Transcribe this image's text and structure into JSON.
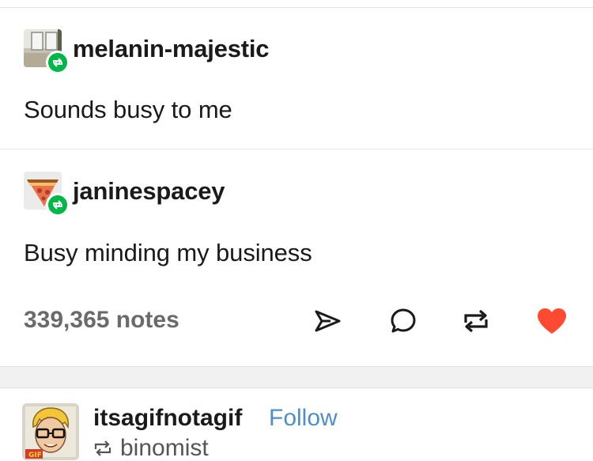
{
  "reblog_chain": [
    {
      "username": "melanin-majestic",
      "text": "Sounds busy to me",
      "avatar_icon": "window-photo"
    },
    {
      "username": "janinespacey",
      "text": "Busy minding my business",
      "avatar_icon": "pizza-slice"
    }
  ],
  "footer": {
    "notes": "339,365 notes",
    "icons": [
      "share-icon",
      "reply-icon",
      "reblog-icon",
      "like-heart-icon"
    ]
  },
  "next_post": {
    "username": "itsagifnotagif",
    "follow_label": "Follow",
    "reblogged_from": "binomist",
    "avatar_icon": "cartoon-avatar",
    "avatar_badge": "GIF"
  },
  "colors": {
    "reblog_green": "#00b845",
    "follow_blue": "#4d8fcc",
    "heart_red": "#ff4930",
    "notes_gray": "#6a6a6a"
  }
}
